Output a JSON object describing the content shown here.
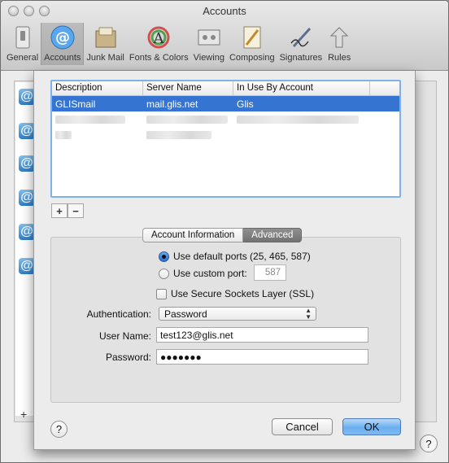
{
  "window": {
    "title": "Accounts"
  },
  "toolbar": {
    "items": [
      {
        "label": "General",
        "icon": "general-switch-icon"
      },
      {
        "label": "Accounts",
        "icon": "at-sign-icon"
      },
      {
        "label": "Junk Mail",
        "icon": "junk-mail-icon"
      },
      {
        "label": "Fonts & Colors",
        "icon": "fonts-colors-icon"
      },
      {
        "label": "Viewing",
        "icon": "viewing-icon"
      },
      {
        "label": "Composing",
        "icon": "composing-icon"
      },
      {
        "label": "Signatures",
        "icon": "signatures-icon"
      },
      {
        "label": "Rules",
        "icon": "rules-icon"
      }
    ],
    "active_index": 1
  },
  "table": {
    "columns": [
      "Description",
      "Server Name",
      "In Use By Account"
    ],
    "rows": [
      {
        "description": "GLISmail",
        "server": "mail.glis.net",
        "in_use": "Glis"
      }
    ]
  },
  "list_controls": {
    "add": "+",
    "remove": "−"
  },
  "tabs": {
    "items": [
      "Account Information",
      "Advanced"
    ],
    "selected": "Advanced"
  },
  "ports": {
    "default_label": "Use default ports (25, 465, 587)",
    "custom_label": "Use custom port:",
    "custom_value": "587",
    "selected": "default"
  },
  "ssl": {
    "label": "Use Secure Sockets Layer (SSL)",
    "checked": false
  },
  "auth": {
    "label": "Authentication:",
    "value": "Password"
  },
  "username": {
    "label": "User Name:",
    "value": "test123@glis.net"
  },
  "password": {
    "label": "Password:",
    "value": "●●●●●●●"
  },
  "buttons": {
    "cancel": "Cancel",
    "ok": "OK",
    "help": "?"
  },
  "colors": {
    "selection": "#3574d0",
    "default_button": "#6aaef0"
  }
}
